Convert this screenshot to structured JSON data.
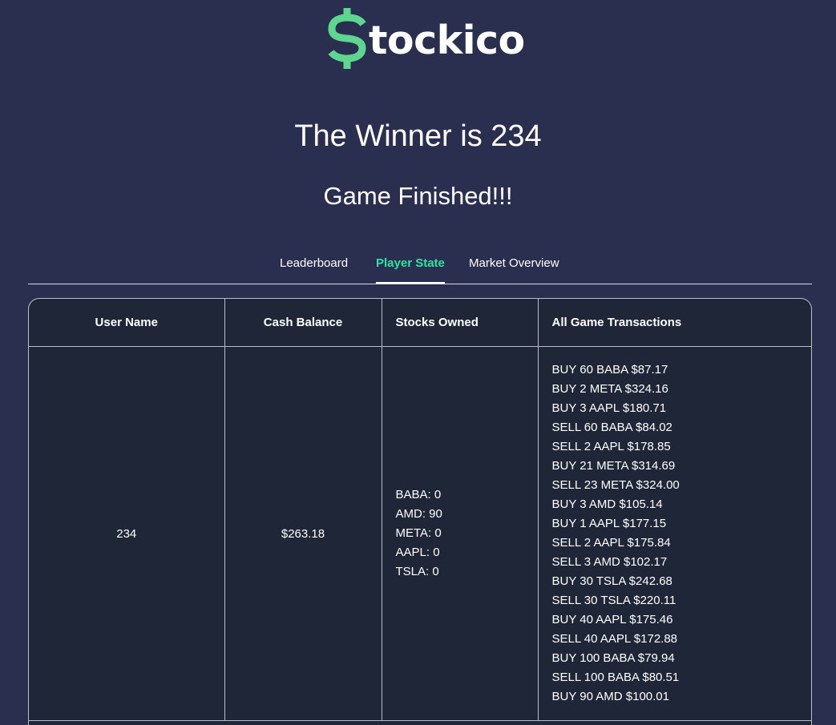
{
  "brand": {
    "name": "tockico",
    "colors": {
      "background": "#2a2f50",
      "accent": "#2fe4a0",
      "logo_green": "#5ed68f",
      "table_bg": "#1f2637"
    }
  },
  "headings": {
    "winner": "The Winner is 234",
    "status": "Game Finished!!!"
  },
  "tabs": [
    {
      "label": "Leaderboard",
      "active": false
    },
    {
      "label": "Player State",
      "active": true
    },
    {
      "label": "Market Overview",
      "active": false
    }
  ],
  "table": {
    "columns": [
      "User Name",
      "Cash Balance",
      "Stocks Owned",
      "All Game Transactions"
    ],
    "row": {
      "user_name": "234",
      "cash_balance": "$263.18",
      "stocks_owned": [
        "BABA: 0",
        "AMD: 90",
        "META: 0",
        "AAPL: 0",
        "TSLA: 0"
      ],
      "transactions": [
        "BUY 60 BABA $87.17",
        "BUY 2 META $324.16",
        "BUY 3 AAPL $180.71",
        "SELL 60 BABA $84.02",
        "SELL 2 AAPL $178.85",
        "BUY 21 META $314.69",
        "SELL 23 META $324.00",
        "BUY 3 AMD $105.14",
        "BUY 1 AAPL $177.15",
        "SELL 2 AAPL $175.84",
        "SELL 3 AMD $102.17",
        "BUY 30 TSLA $242.68",
        "SELL 30 TSLA $220.11",
        "BUY 40 AAPL $175.46",
        "SELL 40 AAPL $172.88",
        "BUY 100 BABA $79.94",
        "SELL 100 BABA $80.51",
        "BUY 90 AMD $100.01"
      ]
    }
  }
}
